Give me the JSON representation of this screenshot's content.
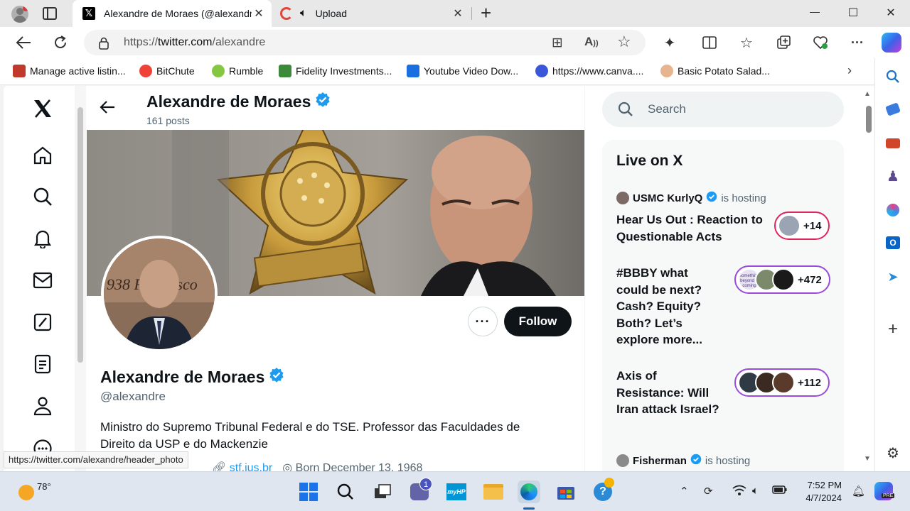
{
  "browser": {
    "tabs": [
      {
        "title": "Alexandre de Moraes (@alexandr",
        "active": true
      },
      {
        "title": "Upload",
        "active": false
      }
    ],
    "new_tab": "+",
    "window_controls": {
      "minimize": "—",
      "maximize": "☐",
      "close": "✕"
    },
    "address": {
      "prefix": "https://",
      "domain": "twitter.com",
      "path": "/alexandre"
    },
    "bookmarks": [
      {
        "label": "Manage active listin...",
        "color": "#c0392b"
      },
      {
        "label": "BitChute",
        "color": "#ef4136"
      },
      {
        "label": "Rumble",
        "color": "#85c742"
      },
      {
        "label": "Fidelity Investments...",
        "color": "#3a8a3a"
      },
      {
        "label": "Youtube Video Dow...",
        "color": "#1a6fe0"
      },
      {
        "label": "https://www.canva....",
        "color": "#3b57d9"
      },
      {
        "label": "Basic Potato Salad...",
        "color": "#e8b48f"
      }
    ],
    "status_url": "https://twitter.com/alexandre/header_photo"
  },
  "profile": {
    "name": "Alexandre de Moraes",
    "posts": "161 posts",
    "handle": "@alexandre",
    "bio": "Ministro do Supremo Tribunal Federal e do TSE. Professor das Faculdades de Direito da USP e do Mackenzie",
    "website": "stf.jus.br",
    "born": "Born December 13, 1968",
    "follow_label": "Follow",
    "more_label": "···",
    "avatar_letters": "938 Francisco"
  },
  "sidebar": {
    "search_placeholder": "Search",
    "live_title": "Live on X",
    "spaces": [
      {
        "host": "USMC KurlyQ",
        "status": "is hosting",
        "title": "Hear Us Out : Reaction to Questionable Acts",
        "count": "+14"
      },
      {
        "title": "#BBBY what could be next? Cash? Equity? Both? Let’s explore more...",
        "count": "+472",
        "avatar_text": "something beyond is coming"
      },
      {
        "title": "Axis of Resistance: Will Iran attack Israel?",
        "count": "+112"
      },
      {
        "host": "Fisherman",
        "status": "is hosting"
      }
    ]
  },
  "taskbar": {
    "temperature": "78°",
    "time": "7:52 PM",
    "date": "4/7/2024",
    "chat_badge": "1",
    "myhp_label": "myHP",
    "copilot_badge": "PRE"
  }
}
